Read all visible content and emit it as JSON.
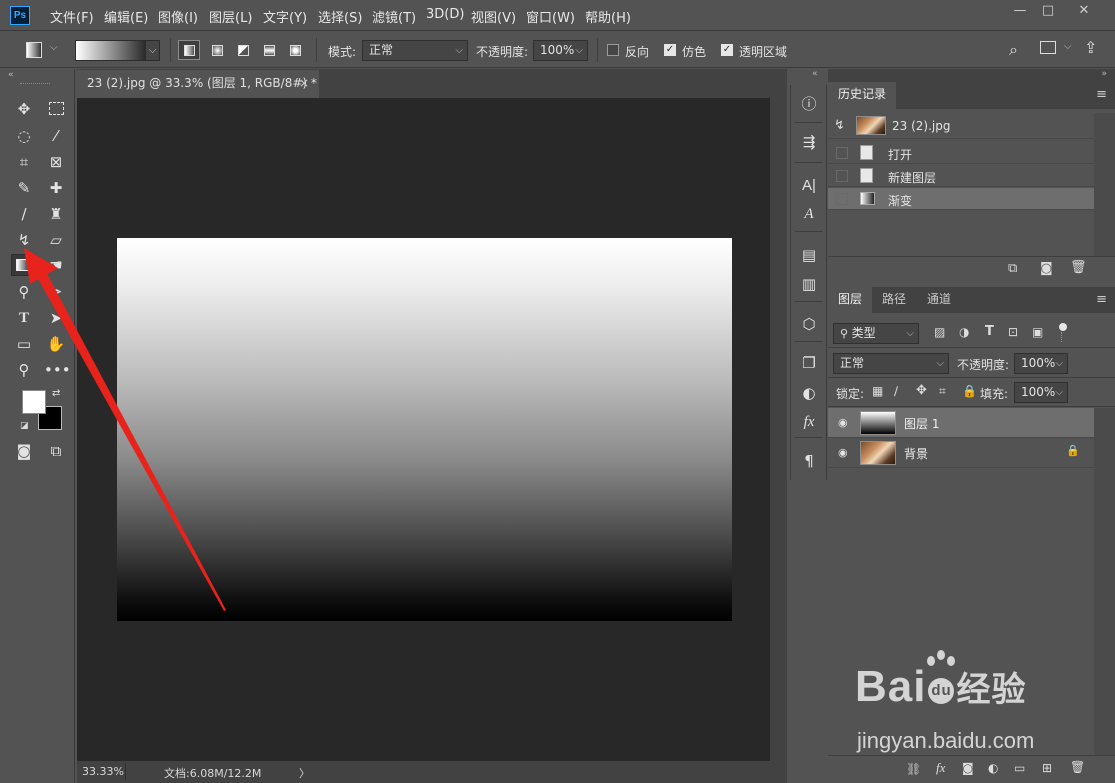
{
  "menu": {
    "app_logo": "Ps",
    "items": [
      "文件(F)",
      "编辑(E)",
      "图像(I)",
      "图层(L)",
      "文字(Y)",
      "选择(S)",
      "滤镜(T)",
      "3D(D)",
      "视图(V)",
      "窗口(W)",
      "帮助(H)"
    ],
    "window_controls": {
      "minimize": "—",
      "maximize": "□",
      "close": "✕"
    }
  },
  "options_bar": {
    "mode_label": "模式:",
    "mode_value": "正常",
    "opacity_label": "不透明度:",
    "opacity_value": "100%",
    "reverse_label": "反向",
    "reverse_checked": false,
    "dither_label": "仿色",
    "dither_checked": true,
    "transparency_label": "透明区域",
    "transparency_checked": true
  },
  "document": {
    "tab_title": "23 (2).jpg @ 33.3% (图层 1, RGB/8#) *",
    "tab_close": "×",
    "zoom": "33.33%",
    "doc_info": "文档:6.08M/12.2M",
    "status_arrow": "〉"
  },
  "colors": {
    "foreground": "#ffffff",
    "background": "#000000",
    "annotation_arrow": "#e8231c",
    "panel_bg": "#535353",
    "canvas_bg": "#282828"
  },
  "history_panel": {
    "tab_label": "历史记录",
    "snapshot_label": "23 (2).jpg",
    "items": [
      {
        "label": "打开",
        "active": false
      },
      {
        "label": "新建图层",
        "active": false
      },
      {
        "label": "渐变",
        "active": true
      }
    ]
  },
  "layers_panel": {
    "tabs": [
      "图层",
      "路径",
      "通道"
    ],
    "filter_kind": "类型",
    "blend_mode": "正常",
    "opacity_label": "不透明度:",
    "opacity_value": "100%",
    "lock_label": "锁定:",
    "fill_label": "填充:",
    "fill_value": "100%",
    "layers": [
      {
        "name": "图层 1",
        "active": true,
        "locked": false
      },
      {
        "name": "背景",
        "active": false,
        "locked": true
      }
    ]
  },
  "watermark": {
    "brand": "Bai",
    "brand_du": "du",
    "product": "经验",
    "url": "jingyan.baidu.com"
  }
}
